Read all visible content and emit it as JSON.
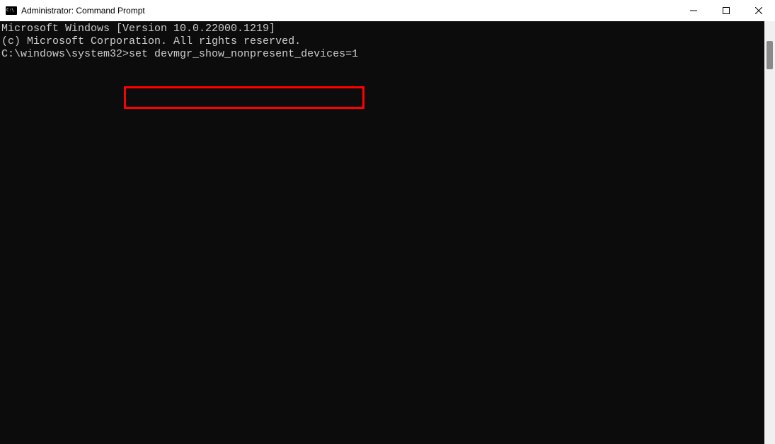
{
  "window": {
    "title": "Administrator: Command Prompt"
  },
  "terminal": {
    "line1": "Microsoft Windows [Version 10.0.22000.1219]",
    "line2": "(c) Microsoft Corporation. All rights reserved.",
    "blank": "",
    "prompt": "C:\\windows\\system32>",
    "command": "set devmgr_show_nonpresent_devices=1"
  },
  "colors": {
    "highlight": "#ff0000",
    "terminal_bg": "#0c0c0c",
    "terminal_fg": "#cccccc"
  }
}
